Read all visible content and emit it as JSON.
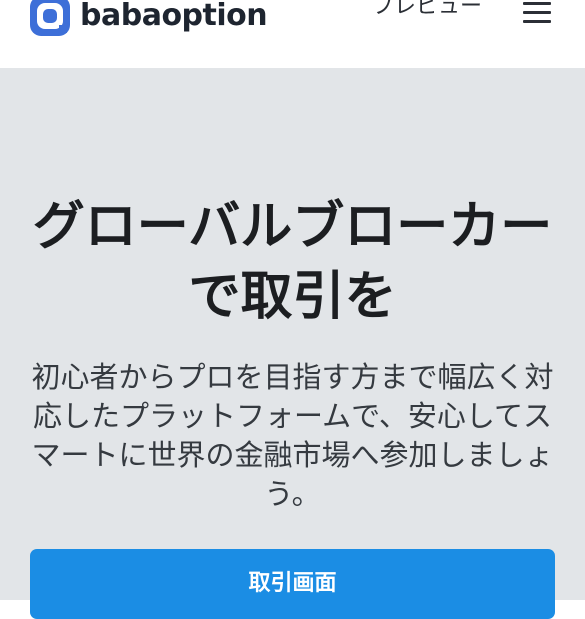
{
  "header": {
    "logo_text": "babaoption",
    "logo_icon": "babaoption-logo-icon",
    "preview_label": "プレビュー",
    "menu_icon": "hamburger-menu-icon"
  },
  "hero": {
    "title": "グローバルブローカーで取引を",
    "description": "初心者からプロを目指す方まで幅広く対応したプラットフォームで、安心してスマートに世界の金融市場へ参加しましょう。",
    "cta_label": "取引画面"
  },
  "colors": {
    "header_bg": "#ffffff",
    "hero_bg": "#e2e5e8",
    "brand_blue": "#3d6fd8",
    "cta_blue": "#1b8de4",
    "title_text": "#1c1e21",
    "body_text": "#353a40"
  }
}
